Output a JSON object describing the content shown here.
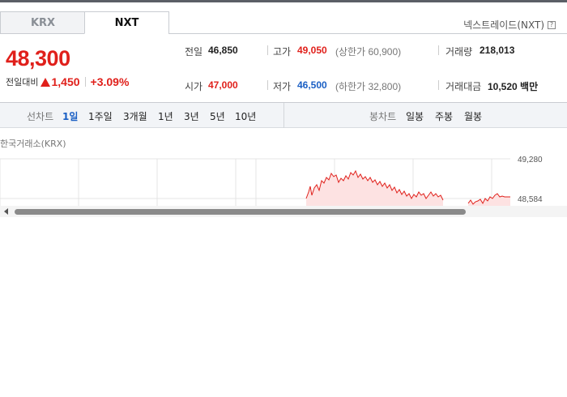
{
  "tabs": [
    {
      "label": "KRX",
      "active": false
    },
    {
      "label": "NXT",
      "active": true
    }
  ],
  "nxt_link": {
    "label": "넥스트레이드(NXT)",
    "help": "?"
  },
  "price": {
    "current": "48,300",
    "change_label": "전일대비",
    "change": "1,450",
    "change_pct": "+3.09%",
    "direction": "up"
  },
  "stats": {
    "prev_close": {
      "label": "전일",
      "value": "46,850"
    },
    "high": {
      "label": "고가",
      "value": "49,050",
      "sub": "(상한가 60,900)"
    },
    "volume": {
      "label": "거래량",
      "value": "218,013"
    },
    "open": {
      "label": "시가",
      "value": "47,000"
    },
    "low": {
      "label": "저가",
      "value": "46,500",
      "sub": "(하한가 32,800)"
    },
    "amount": {
      "label": "거래대금",
      "value": "10,520 백만"
    }
  },
  "toolbar": {
    "line_label": "선차트",
    "line_periods": [
      "1일",
      "1주일",
      "3개월",
      "1년",
      "3년",
      "5년",
      "10년"
    ],
    "active_period": "1일",
    "candle_label": "봉차트",
    "candle_periods": [
      "일봉",
      "주봉",
      "월봉"
    ]
  },
  "chart": {
    "source_label": "한국거래소(KRX)",
    "y_labels": [
      "49,280",
      "48,584"
    ]
  },
  "colors": {
    "up": "#e0201b",
    "down": "#1a5fc4",
    "active": "#1a5fc4"
  }
}
